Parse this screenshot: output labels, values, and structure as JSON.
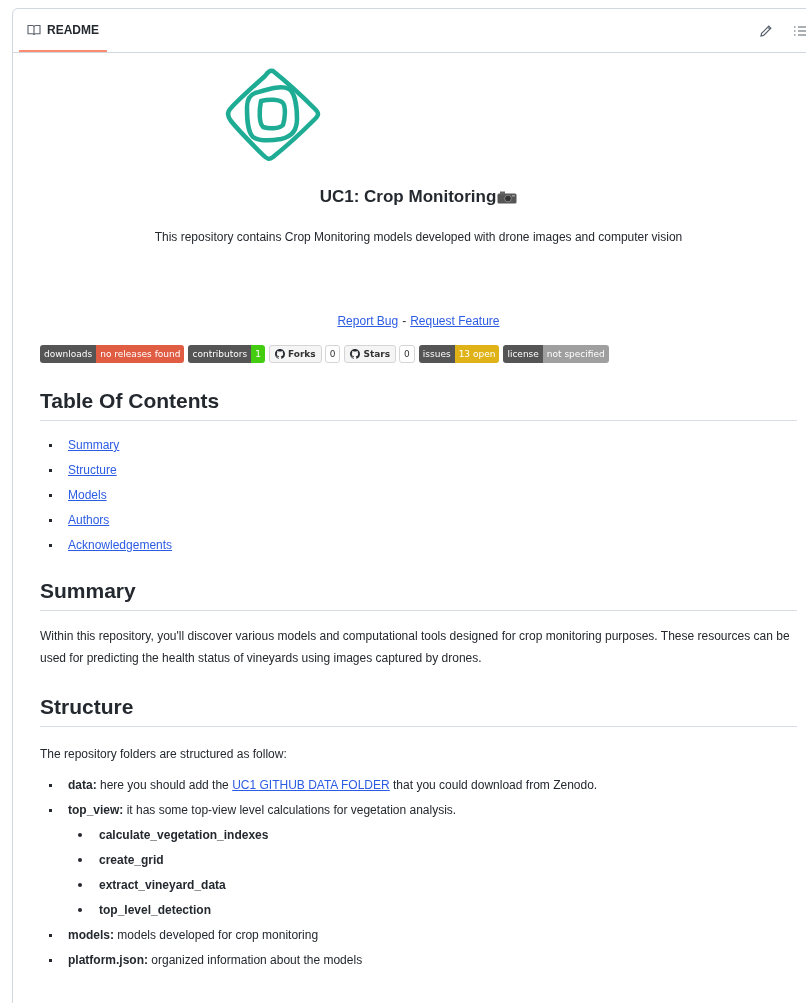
{
  "tab": {
    "label": "README",
    "selected": true
  },
  "title": "UC1: Crop Monitoring",
  "description": "This repository contains Crop Monitoring models developed with drone images and computer vision",
  "links": [
    {
      "label": "Report Bug"
    },
    {
      "label": "Request Feature"
    }
  ],
  "link_separator": "-",
  "badges": [
    {
      "kind": "flat",
      "label": "downloads",
      "value": "no releases found",
      "color": "#e05d44"
    },
    {
      "kind": "flat",
      "label": "contributors",
      "value": "1",
      "color": "#44cc11"
    },
    {
      "kind": "social",
      "label": "Forks",
      "value": "0"
    },
    {
      "kind": "social",
      "label": "Stars",
      "value": "0"
    },
    {
      "kind": "flat",
      "label": "issues",
      "value": "13 open",
      "color": "#dfb317"
    },
    {
      "kind": "flat",
      "label": "license",
      "value": "not specified",
      "color": "#9f9f9f"
    }
  ],
  "sections": [
    {
      "heading": "Table Of Contents",
      "kind": "toc",
      "items": [
        {
          "link": "Summary"
        },
        {
          "link": "Structure"
        },
        {
          "link": "Models"
        },
        {
          "link": "Authors"
        },
        {
          "link": "Acknowledgements"
        }
      ]
    },
    {
      "heading": "Summary",
      "kind": "text",
      "paragraph": "Within this repository, you'll discover various models and computational tools designed for crop monitoring purposes. These resources can be used for predicting the health status of vineyards using images captured by drones."
    },
    {
      "heading": "Structure",
      "kind": "list",
      "intro": "The repository folders are structured as follow:",
      "items": [
        {
          "text": "**data:** here you should add the",
          "link": "UC1 GITHUB DATA FOLDER",
          "after": "that you could download from Zenodo."
        },
        {
          "text": "**top_view:** it has some top-view level calculations for vegetation analysis.",
          "children": [
            {
              "text": "**calculate_vegetation_indexes**"
            },
            {
              "text": "**create_grid**"
            },
            {
              "text": "**extract_vineyard_data**"
            },
            {
              "text": "**top_level_detection**"
            }
          ]
        },
        {
          "text": "**models:** models developed for crop monitoring"
        },
        {
          "text": "**platform.json:** organized information about the models"
        }
      ]
    }
  ]
}
